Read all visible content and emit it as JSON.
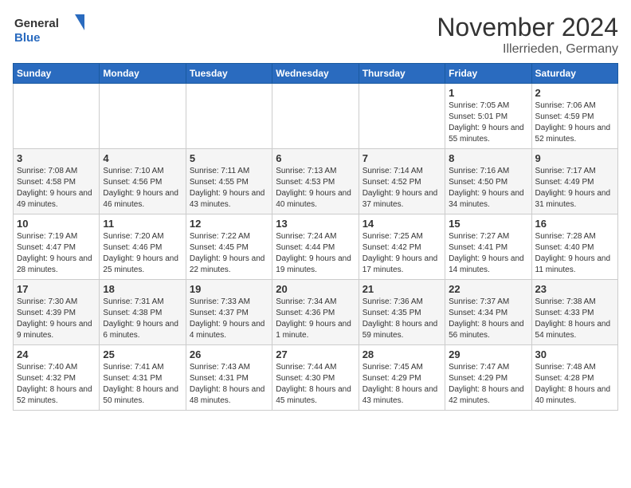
{
  "logo": {
    "text_general": "General",
    "text_blue": "Blue"
  },
  "title": {
    "month": "November 2024",
    "location": "Illerrieden, Germany"
  },
  "weekdays": [
    "Sunday",
    "Monday",
    "Tuesday",
    "Wednesday",
    "Thursday",
    "Friday",
    "Saturday"
  ],
  "weeks": [
    [
      {
        "day": "",
        "info": ""
      },
      {
        "day": "",
        "info": ""
      },
      {
        "day": "",
        "info": ""
      },
      {
        "day": "",
        "info": ""
      },
      {
        "day": "",
        "info": ""
      },
      {
        "day": "1",
        "info": "Sunrise: 7:05 AM\nSunset: 5:01 PM\nDaylight: 9 hours and 55 minutes."
      },
      {
        "day": "2",
        "info": "Sunrise: 7:06 AM\nSunset: 4:59 PM\nDaylight: 9 hours and 52 minutes."
      }
    ],
    [
      {
        "day": "3",
        "info": "Sunrise: 7:08 AM\nSunset: 4:58 PM\nDaylight: 9 hours and 49 minutes."
      },
      {
        "day": "4",
        "info": "Sunrise: 7:10 AM\nSunset: 4:56 PM\nDaylight: 9 hours and 46 minutes."
      },
      {
        "day": "5",
        "info": "Sunrise: 7:11 AM\nSunset: 4:55 PM\nDaylight: 9 hours and 43 minutes."
      },
      {
        "day": "6",
        "info": "Sunrise: 7:13 AM\nSunset: 4:53 PM\nDaylight: 9 hours and 40 minutes."
      },
      {
        "day": "7",
        "info": "Sunrise: 7:14 AM\nSunset: 4:52 PM\nDaylight: 9 hours and 37 minutes."
      },
      {
        "day": "8",
        "info": "Sunrise: 7:16 AM\nSunset: 4:50 PM\nDaylight: 9 hours and 34 minutes."
      },
      {
        "day": "9",
        "info": "Sunrise: 7:17 AM\nSunset: 4:49 PM\nDaylight: 9 hours and 31 minutes."
      }
    ],
    [
      {
        "day": "10",
        "info": "Sunrise: 7:19 AM\nSunset: 4:47 PM\nDaylight: 9 hours and 28 minutes."
      },
      {
        "day": "11",
        "info": "Sunrise: 7:20 AM\nSunset: 4:46 PM\nDaylight: 9 hours and 25 minutes."
      },
      {
        "day": "12",
        "info": "Sunrise: 7:22 AM\nSunset: 4:45 PM\nDaylight: 9 hours and 22 minutes."
      },
      {
        "day": "13",
        "info": "Sunrise: 7:24 AM\nSunset: 4:44 PM\nDaylight: 9 hours and 19 minutes."
      },
      {
        "day": "14",
        "info": "Sunrise: 7:25 AM\nSunset: 4:42 PM\nDaylight: 9 hours and 17 minutes."
      },
      {
        "day": "15",
        "info": "Sunrise: 7:27 AM\nSunset: 4:41 PM\nDaylight: 9 hours and 14 minutes."
      },
      {
        "day": "16",
        "info": "Sunrise: 7:28 AM\nSunset: 4:40 PM\nDaylight: 9 hours and 11 minutes."
      }
    ],
    [
      {
        "day": "17",
        "info": "Sunrise: 7:30 AM\nSunset: 4:39 PM\nDaylight: 9 hours and 9 minutes."
      },
      {
        "day": "18",
        "info": "Sunrise: 7:31 AM\nSunset: 4:38 PM\nDaylight: 9 hours and 6 minutes."
      },
      {
        "day": "19",
        "info": "Sunrise: 7:33 AM\nSunset: 4:37 PM\nDaylight: 9 hours and 4 minutes."
      },
      {
        "day": "20",
        "info": "Sunrise: 7:34 AM\nSunset: 4:36 PM\nDaylight: 9 hours and 1 minute."
      },
      {
        "day": "21",
        "info": "Sunrise: 7:36 AM\nSunset: 4:35 PM\nDaylight: 8 hours and 59 minutes."
      },
      {
        "day": "22",
        "info": "Sunrise: 7:37 AM\nSunset: 4:34 PM\nDaylight: 8 hours and 56 minutes."
      },
      {
        "day": "23",
        "info": "Sunrise: 7:38 AM\nSunset: 4:33 PM\nDaylight: 8 hours and 54 minutes."
      }
    ],
    [
      {
        "day": "24",
        "info": "Sunrise: 7:40 AM\nSunset: 4:32 PM\nDaylight: 8 hours and 52 minutes."
      },
      {
        "day": "25",
        "info": "Sunrise: 7:41 AM\nSunset: 4:31 PM\nDaylight: 8 hours and 50 minutes."
      },
      {
        "day": "26",
        "info": "Sunrise: 7:43 AM\nSunset: 4:31 PM\nDaylight: 8 hours and 48 minutes."
      },
      {
        "day": "27",
        "info": "Sunrise: 7:44 AM\nSunset: 4:30 PM\nDaylight: 8 hours and 45 minutes."
      },
      {
        "day": "28",
        "info": "Sunrise: 7:45 AM\nSunset: 4:29 PM\nDaylight: 8 hours and 43 minutes."
      },
      {
        "day": "29",
        "info": "Sunrise: 7:47 AM\nSunset: 4:29 PM\nDaylight: 8 hours and 42 minutes."
      },
      {
        "day": "30",
        "info": "Sunrise: 7:48 AM\nSunset: 4:28 PM\nDaylight: 8 hours and 40 minutes."
      }
    ]
  ]
}
